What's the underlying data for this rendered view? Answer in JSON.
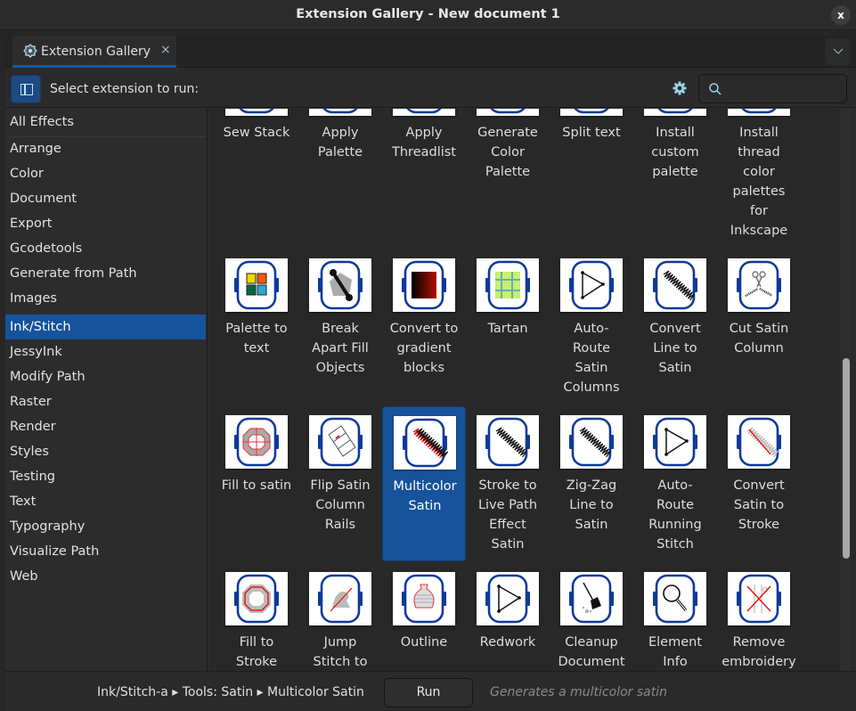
{
  "window": {
    "title": "Extension Gallery - New document 1",
    "close_label": "x"
  },
  "tab": {
    "label": "Extension Gallery",
    "close_label": "×",
    "icon": "puzzle-gear-icon"
  },
  "tab_menu_icon": "chevron-down-icon",
  "toolbar": {
    "prompt": "Select extension to run:",
    "sidebar_toggle_icon": "sidebar-icon",
    "settings_icon": "gear-icon",
    "search": {
      "value": "",
      "placeholder": "",
      "icon": "search-icon"
    }
  },
  "sidebar": {
    "selected": "Ink/Stitch",
    "categories": [
      "All Effects",
      "Arrange",
      "Color",
      "Document",
      "Export",
      "Gcodetools",
      "Generate from Path",
      "Images",
      "Ink/Stitch",
      "JessyInk",
      "Modify Path",
      "Raster",
      "Render",
      "Styles",
      "Testing",
      "Text",
      "Typography",
      "Visualize Path",
      "Web"
    ]
  },
  "gallery": {
    "selected": "Multicolor Satin",
    "rows": [
      [
        {
          "label": "Sew Stack",
          "icon": "sew-stack-icon"
        },
        {
          "label": "Apply\nPalette",
          "icon": "apply-palette-icon"
        },
        {
          "label": "Apply\nThreadlist",
          "icon": "apply-threadlist-icon"
        },
        {
          "label": "Generate\nColor\nPalette",
          "icon": "generate-palette-icon"
        },
        {
          "label": "Split text",
          "icon": "split-text-icon"
        },
        {
          "label": "Install\ncustom\npalette",
          "icon": "install-palette-icon"
        },
        {
          "label": "Install\nthread\ncolor\npalettes\nfor\nInkscape",
          "icon": "install-thread-palettes-icon"
        }
      ],
      [
        {
          "label": "Palette to\ntext",
          "icon": "palette-to-text-icon"
        },
        {
          "label": "Break\nApart Fill\nObjects",
          "icon": "wrench-icon"
        },
        {
          "label": "Convert to\ngradient\nblocks",
          "icon": "gradient-blocks-icon"
        },
        {
          "label": "Tartan",
          "icon": "tartan-icon"
        },
        {
          "label": "Auto-\nRoute\nSatin\nColumns",
          "icon": "auto-route-icon"
        },
        {
          "label": "Convert\nLine to\nSatin",
          "icon": "satin-zigzag-icon"
        },
        {
          "label": "Cut Satin\nColumn",
          "icon": "scissors-icon"
        }
      ],
      [
        {
          "label": "Fill to satin",
          "icon": "fill-to-satin-icon"
        },
        {
          "label": "Flip Satin\nColumn\nRails",
          "icon": "flip-rails-icon"
        },
        {
          "label": "Multicolor\nSatin",
          "icon": "multicolor-satin-icon"
        },
        {
          "label": "Stroke to\nLive Path\nEffect\nSatin",
          "icon": "satin-zigzag-icon"
        },
        {
          "label": "Zig-Zag\nLine to\nSatin",
          "icon": "satin-zigzag-icon"
        },
        {
          "label": "Auto-\nRoute\nRunning\nStitch",
          "icon": "auto-route-icon"
        },
        {
          "label": "Convert\nSatin to\nStroke",
          "icon": "satin-to-stroke-icon"
        }
      ],
      [
        {
          "label": "Fill to\nStroke",
          "icon": "fill-to-stroke-icon"
        },
        {
          "label": "Jump\nStitch to",
          "icon": "jump-stitch-icon"
        },
        {
          "label": "Outline",
          "icon": "outline-vase-icon"
        },
        {
          "label": "Redwork",
          "icon": "auto-route-icon"
        },
        {
          "label": "Cleanup\nDocument",
          "icon": "broom-icon"
        },
        {
          "label": "Element\nInfo",
          "icon": "magnifier-icon"
        },
        {
          "label": "Remove\nembroidery",
          "icon": "remove-embroidery-icon"
        }
      ]
    ]
  },
  "footer": {
    "breadcrumb": "Ink/Stitch-a ▸ Tools: Satin ▸ Multicolor Satin",
    "run_label": "Run",
    "description": "Generates a multicolor satin"
  },
  "colors": {
    "accent": "#16539b",
    "hoop": "#0d3a9a",
    "background": "#282828"
  }
}
